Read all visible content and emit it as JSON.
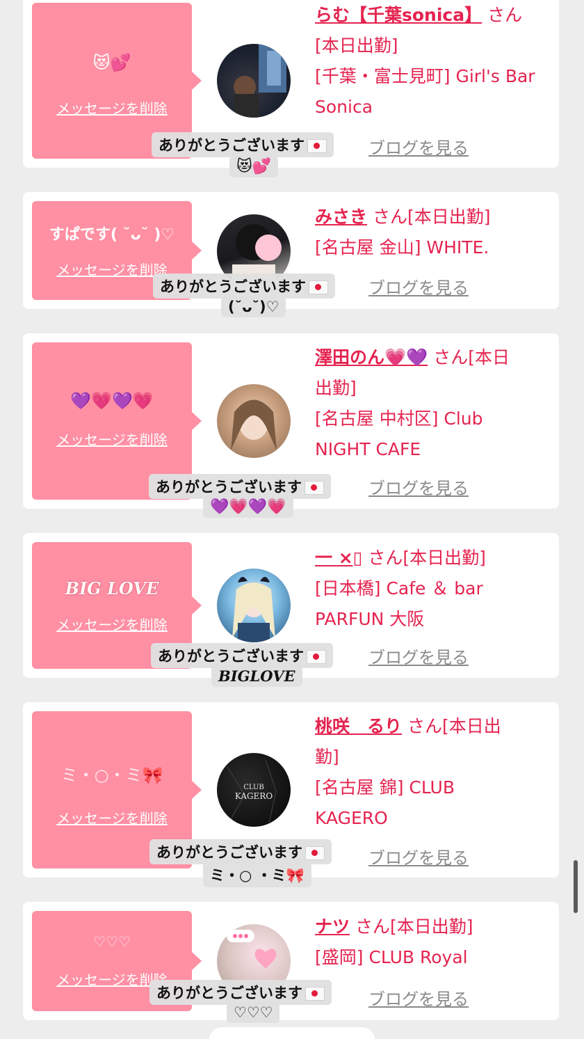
{
  "colors": {
    "background": "#ededed",
    "card": "#ffffff",
    "bubble": "#ff8fa3",
    "name_text": "#e5234f",
    "link_gray": "#8a8a8a",
    "tooltip_bg": "#e0e0e0"
  },
  "common": {
    "delete_label": "メッセージを削除",
    "blog_label": "ブログを見る",
    "thanks_label": "ありがとうございます",
    "envelope_icon": "love-letter-icon"
  },
  "cards": [
    {
      "message": "😻💕",
      "name": "らむ【千葉sonica】",
      "suffix": " さん",
      "line1": "[本日出勤]",
      "line2": "[千葉・富士見町] Girl's Bar",
      "line3": "Sonica",
      "line4": "",
      "tip_line2": "😻💕"
    },
    {
      "message": "すぱです( ˘ᴗ˘ )♡",
      "name": "みさき",
      "suffix": " さん[本日出勤]",
      "line1": "[名古屋 金山] WHITE.",
      "line2": "",
      "line3": "",
      "line4": "",
      "tip_line2": "(˘ᴗ˘)♡"
    },
    {
      "message": "💜💗💜💗",
      "name": "澤田のん💗💜",
      "suffix": " さん[本日",
      "line1": "出勤]",
      "line2": "[名古屋 中村区] Club",
      "line3": "NIGHT CAFE",
      "line4": "",
      "tip_line2": "💜💗💜💗"
    },
    {
      "message": "BIG LOVE",
      "name": "一 ×▯",
      "suffix": " さん[本日出勤]",
      "line1": "[日本橋] Cafe ＆ bar",
      "line2": "PARFUN 大阪",
      "line3": "",
      "line4": "",
      "tip_line2": "BIGLOVE"
    },
    {
      "message": "ミ・○・ミ🎀",
      "name": "桃咲　るり",
      "suffix": " さん[本日出",
      "line1": "勤]",
      "line2": "[名古屋 錦] CLUB",
      "line3": "KAGERO",
      "line4": "",
      "tip_line2": "ミ・○ ・ミ🎀"
    },
    {
      "message": "♡♡♡",
      "name": "ナツ",
      "suffix": " さん[本日出勤]",
      "line1": "[盛岡] CLUB Royal",
      "line2": "",
      "line3": "",
      "line4": "",
      "tip_line2": "♡♡♡"
    }
  ]
}
